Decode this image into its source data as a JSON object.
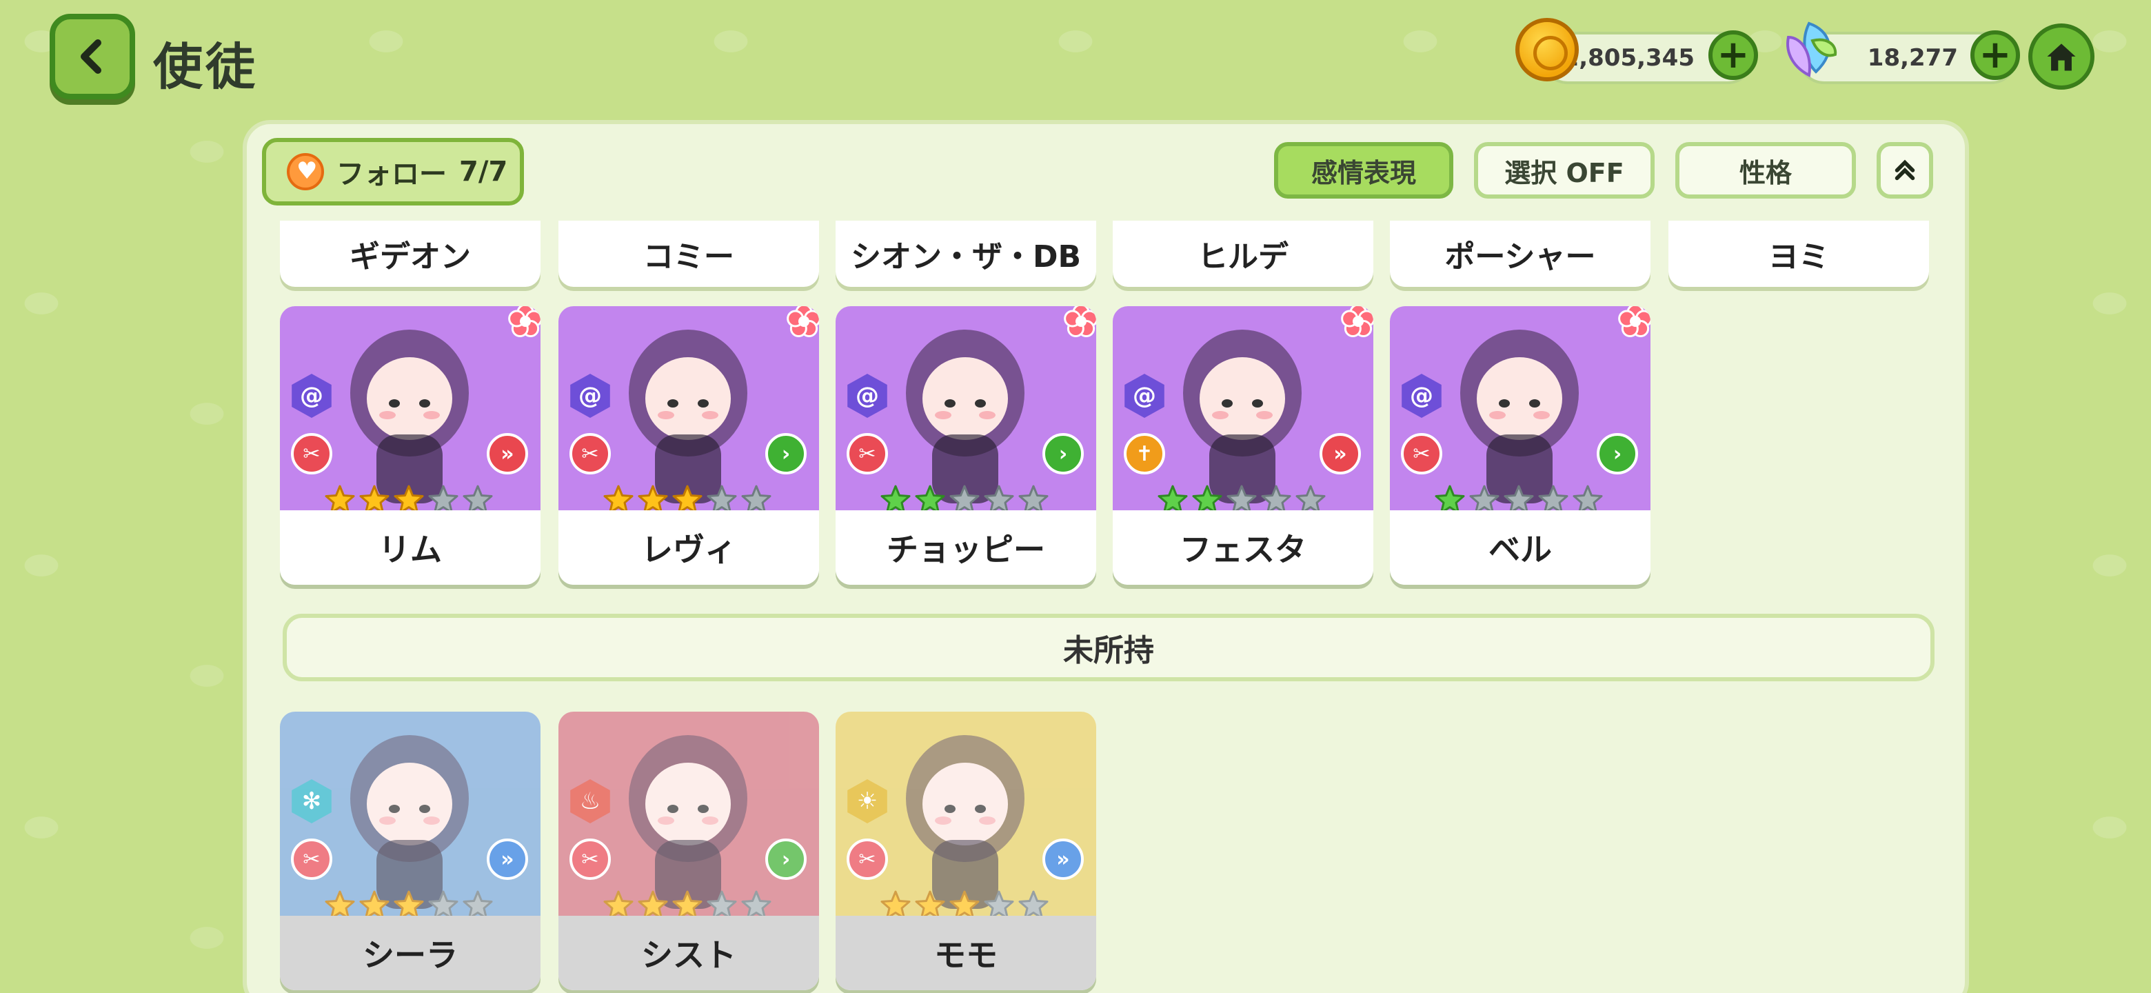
{
  "header": {
    "title": "使徒",
    "gold": "2,805,345",
    "crystals": "18,277"
  },
  "toolbar": {
    "follow_label": "フォロー",
    "follow_count": "7/7",
    "emotion_label": "感情表現",
    "select_label": "選択 OFF",
    "personality_label": "性格"
  },
  "partial_row": {
    "names": [
      "ギデオン",
      "コミー",
      "シオン・ザ・DB",
      "ヒルデ",
      "ポーシャー",
      "ヨミ"
    ]
  },
  "owned": [
    {
      "name": "リム",
      "stars": 3,
      "star_color": "gold",
      "element": "swirl-icon",
      "element_color": "#6e4fd8",
      "role": "attack-icon",
      "role_color": "#ea4b55",
      "position": "double-chevron-icon",
      "position_color": "#e9474f",
      "bg": "#c285ee"
    },
    {
      "name": "レヴィ",
      "stars": 3,
      "star_color": "gold",
      "element": "swirl-icon",
      "element_color": "#6e4fd8",
      "role": "attack-icon",
      "role_color": "#ea4b55",
      "position": "chevron-icon",
      "position_color": "#3fb133",
      "bg": "#c285ee"
    },
    {
      "name": "チョッピー",
      "stars": 2,
      "star_color": "green",
      "element": "swirl-icon",
      "element_color": "#6e4fd8",
      "role": "attack-icon",
      "role_color": "#ea4b55",
      "position": "chevron-icon",
      "position_color": "#3fb133",
      "bg": "#c285ee"
    },
    {
      "name": "フェスタ",
      "stars": 2,
      "star_color": "green",
      "element": "swirl-icon",
      "element_color": "#6e4fd8",
      "role": "cross-icon",
      "role_color": "#f19c1a",
      "position": "double-chevron-icon",
      "position_color": "#e9474f",
      "bg": "#c285ee"
    },
    {
      "name": "ベル",
      "stars": 1,
      "star_color": "green",
      "element": "swirl-icon",
      "element_color": "#6e4fd8",
      "role": "attack-icon",
      "role_color": "#ea4b55",
      "position": "chevron-icon",
      "position_color": "#3fb133",
      "bg": "#c285ee"
    }
  ],
  "unowned_section": {
    "label": "未所持"
  },
  "unowned": [
    {
      "name": "シーラ",
      "stars": 3,
      "star_color": "gold",
      "element": "snowflake-icon",
      "element_color": "#2bb3c9",
      "role": "attack-icon",
      "role_color": "#ea4b55",
      "position": "double-chevron-icon",
      "position_color": "#2f7de0",
      "bg": "#7aa8d8"
    },
    {
      "name": "シスト",
      "stars": 3,
      "star_color": "gold",
      "element": "fire-icon",
      "element_color": "#e24a3b",
      "role": "attack-icon",
      "role_color": "#ea4b55",
      "position": "chevron-icon",
      "position_color": "#3fb133",
      "bg": "#d47480"
    },
    {
      "name": "モモ",
      "stars": 3,
      "star_color": "gold",
      "element": "sun-icon",
      "element_color": "#e0b21c",
      "role": "attack-icon",
      "role_color": "#ea4b55",
      "position": "double-chevron-icon",
      "position_color": "#2f7de0",
      "bg": "#e6cf63"
    }
  ],
  "colors": {
    "background": "#c6e08a",
    "panel": "#eef6dc",
    "accent_green": "#6dbb35"
  }
}
